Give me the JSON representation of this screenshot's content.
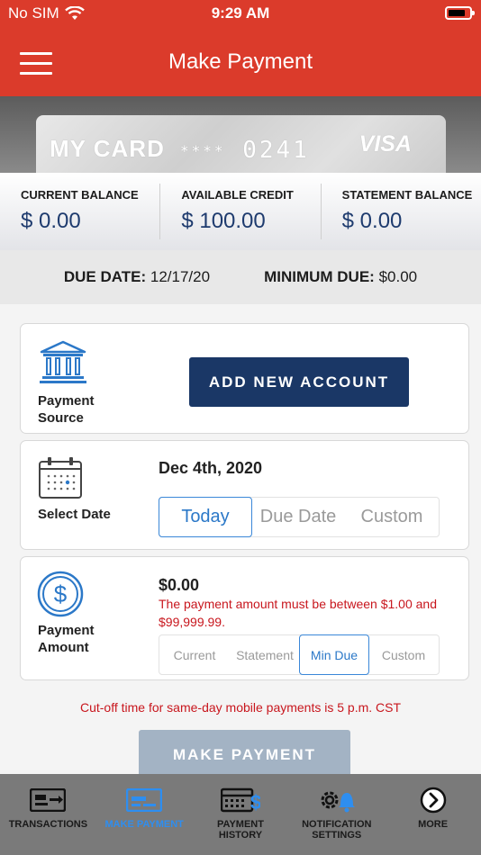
{
  "status": {
    "carrier": "No SIM",
    "time": "9:29 AM"
  },
  "nav": {
    "title": "Make Payment",
    "menu_icon": "hamburger-menu-icon"
  },
  "card": {
    "name": "MY CARD",
    "mask": "****",
    "last4": "0241",
    "brand": "VISA"
  },
  "balances": [
    {
      "label": "CURRENT BALANCE",
      "value": "$ 0.00"
    },
    {
      "label": "AVAILABLE CREDIT",
      "value": "$ 100.00"
    },
    {
      "label": "STATEMENT BALANCE",
      "value": "$ 0.00"
    }
  ],
  "due": {
    "date_label": "DUE DATE:",
    "date_value": "12/17/20",
    "min_label": "MINIMUM DUE:",
    "min_value": "$0.00"
  },
  "source": {
    "label_line1": "Payment",
    "label_line2": "Source",
    "add_button": "ADD NEW ACCOUNT",
    "icon": "bank-icon"
  },
  "date": {
    "label": "Select Date",
    "value": "Dec 4th, 2020",
    "options": [
      "Today",
      "Due Date",
      "Custom"
    ],
    "selected": "Today",
    "icon": "calendar-icon"
  },
  "amount": {
    "label_line1": "Payment",
    "label_line2": "Amount",
    "value": "$0.00",
    "error": "The payment amount must be between $1.00 and $99,999.99.",
    "options": [
      "Current",
      "Statement",
      "Min Due",
      "Custom"
    ],
    "selected": "Min Due",
    "icon": "dollar-circle-icon"
  },
  "cutoff": "Cut-off time for same-day mobile payments is 5 p.m. CST",
  "make_payment": "MAKE PAYMENT",
  "tabs": [
    {
      "label": "TRANSACTIONS",
      "icon": "transactions-icon"
    },
    {
      "label": "MAKE PAYMENT",
      "icon": "card-payment-icon",
      "active": true
    },
    {
      "label": "PAYMENT\nHISTORY",
      "icon": "payment-history-icon"
    },
    {
      "label": "NOTIFICATION\nSETTINGS",
      "icon": "notification-settings-icon"
    },
    {
      "label": "MORE",
      "icon": "chevron-right-circle-icon"
    }
  ],
  "colors": {
    "brand_red": "#db3b2b",
    "navy": "#1a3766",
    "accent_blue": "#2b78c8",
    "error_red": "#c8161d",
    "active_tab": "#2e8ef0"
  }
}
